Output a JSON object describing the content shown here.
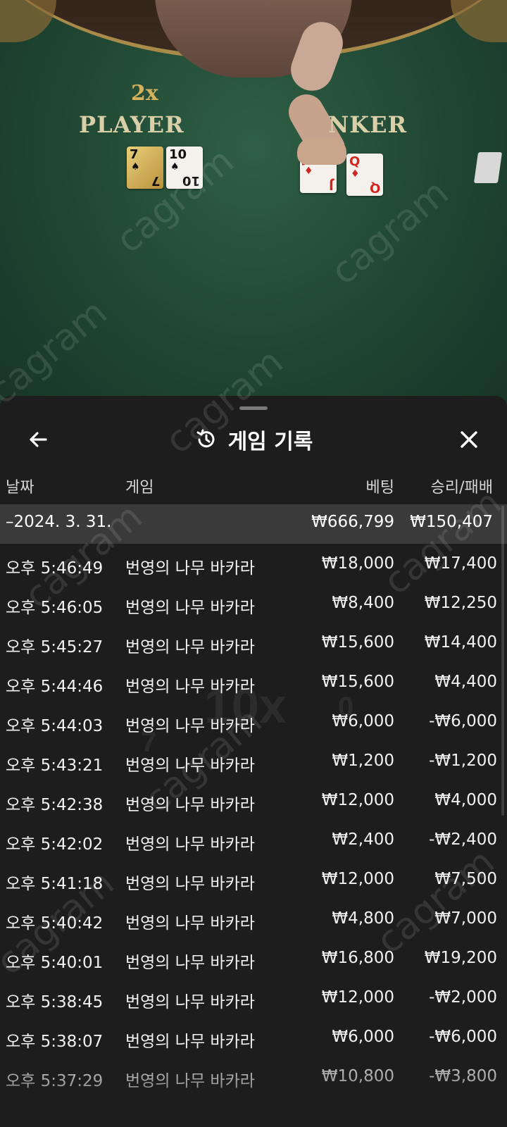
{
  "table": {
    "multiplier": "2x",
    "player_label": "PLAYER",
    "banker_label": "NKER",
    "player_cards": [
      {
        "rank": "7",
        "suit": "♠",
        "style": "gold"
      },
      {
        "rank": "10",
        "suit": "♠",
        "style": "plain"
      }
    ],
    "banker_cards": [
      {
        "rank": "J",
        "suit": "♦",
        "style": "red"
      },
      {
        "rank": "Q",
        "suit": "♦",
        "style": "red"
      }
    ],
    "watermark": "cagram"
  },
  "sheet": {
    "title": "게임 기록",
    "title_icon": "history-icon",
    "back_icon": "arrow-left-icon",
    "close_icon": "close-icon",
    "columns": {
      "date": "날짜",
      "game": "게임",
      "bet": "베팅",
      "result": "승리/패배"
    },
    "summary": {
      "date": "–2024. 3. 31.",
      "bet": "₩666,799",
      "result": "₩150,407"
    },
    "rows": [
      {
        "time": "오후 5:46:49",
        "game": "번영의 나무 바카라",
        "bet": "₩18,000",
        "result": "₩17,400"
      },
      {
        "time": "오후 5:46:05",
        "game": "번영의 나무 바카라",
        "bet": "₩8,400",
        "result": "₩12,250"
      },
      {
        "time": "오후 5:45:27",
        "game": "번영의 나무 바카라",
        "bet": "₩15,600",
        "result": "₩14,400"
      },
      {
        "time": "오후 5:44:46",
        "game": "번영의 나무 바카라",
        "bet": "₩15,600",
        "result": "₩4,400"
      },
      {
        "time": "오후 5:44:03",
        "game": "번영의 나무 바카라",
        "bet": "₩6,000",
        "result": "-₩6,000"
      },
      {
        "time": "오후 5:43:21",
        "game": "번영의 나무 바카라",
        "bet": "₩1,200",
        "result": "-₩1,200"
      },
      {
        "time": "오후 5:42:38",
        "game": "번영의 나무 바카라",
        "bet": "₩12,000",
        "result": "₩4,000"
      },
      {
        "time": "오후 5:42:02",
        "game": "번영의 나무 바카라",
        "bet": "₩2,400",
        "result": "-₩2,400"
      },
      {
        "time": "오후 5:41:18",
        "game": "번영의 나무 바카라",
        "bet": "₩12,000",
        "result": "₩7,500"
      },
      {
        "time": "오후 5:40:42",
        "game": "번영의 나무 바카라",
        "bet": "₩4,800",
        "result": "₩7,000"
      },
      {
        "time": "오후 5:40:01",
        "game": "번영의 나무 바카라",
        "bet": "₩16,800",
        "result": "₩19,200"
      },
      {
        "time": "오후 5:38:45",
        "game": "번영의 나무 바카라",
        "bet": "₩12,000",
        "result": "-₩2,000"
      },
      {
        "time": "오후 5:38:07",
        "game": "번영의 나무 바카라",
        "bet": "₩6,000",
        "result": "-₩6,000"
      },
      {
        "time": "오후 5:37:29",
        "game": "번영의 나무 바카라",
        "bet": "₩10,800",
        "result": "-₩3,800"
      }
    ]
  },
  "colors": {
    "felt": "#224a35",
    "sheet_bg": "#1d1d1d",
    "summary_bg": "#3a3a3a",
    "gold_text": "#d9cfa8",
    "card_red": "#d0261f"
  }
}
